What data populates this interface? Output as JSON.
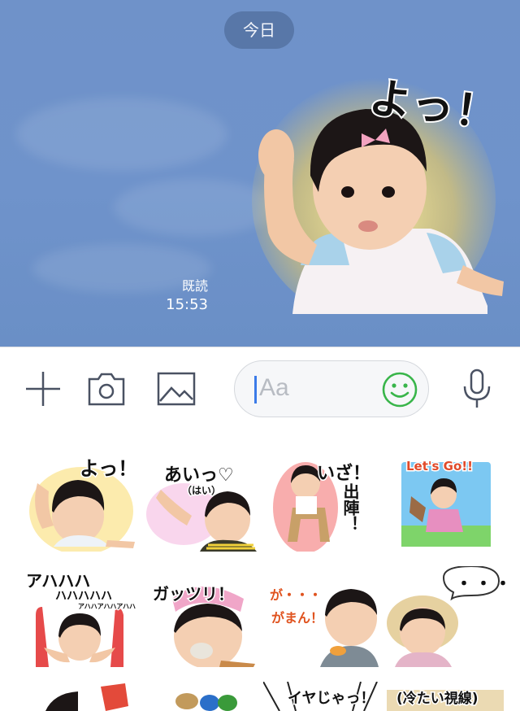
{
  "chat": {
    "date_label": "今日",
    "read_label": "既読",
    "time": "15:53",
    "sticker_caption": "よっ！"
  },
  "input_bar": {
    "placeholder": "Aa",
    "icons": [
      "plus-icon",
      "camera-icon",
      "image-icon",
      "emoji-icon",
      "microphone-icon"
    ],
    "accent_color": "#39b54a",
    "caret_color": "#3b7be8"
  },
  "stickers": [
    {
      "caption": "よっ！",
      "glow": "#fbe38a"
    },
    {
      "caption": "あいっ♡",
      "sub": "（はい）",
      "glow": "#f6c4e6"
    },
    {
      "caption": "いざ！",
      "side": "出陣！",
      "glow": "#f26a6a"
    },
    {
      "caption": "Let's Go!!",
      "glow": "#7cc8f2"
    },
    {
      "caption": "アハハハ",
      "sub": "ハハハハハ",
      "sub2": "アハハアハハアハハ",
      "glow": "#ffffff"
    },
    {
      "caption": "ガッツリ！",
      "glow": "#ffffff"
    },
    {
      "caption": "が・・・",
      "sub": "がまん！",
      "glow": "#ffffff"
    },
    {
      "caption": "・・・",
      "glow": "#ffffff"
    },
    {
      "caption": "",
      "glow": "#ffffff"
    },
    {
      "caption": "",
      "glow": "#ffffff"
    },
    {
      "caption": "イヤじゃっ！",
      "glow": "#ffffff"
    },
    {
      "caption": "(冷たい視線)",
      "glow": "#ffffff"
    }
  ]
}
